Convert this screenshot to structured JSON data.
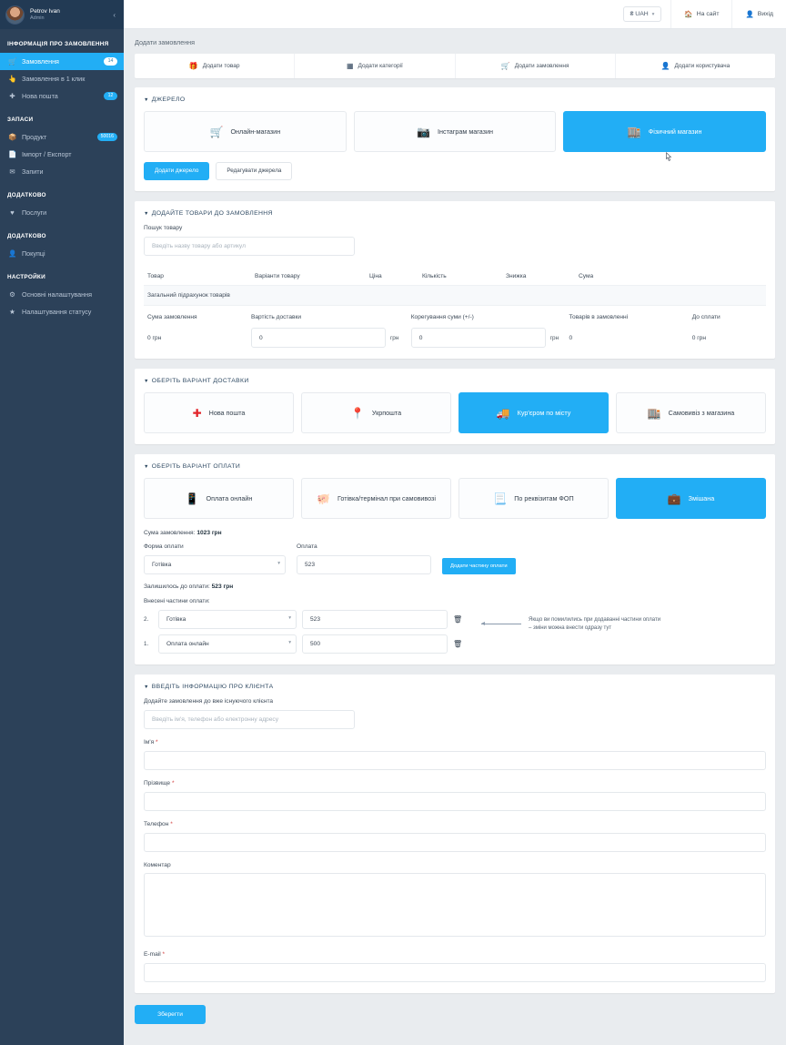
{
  "sidebar": {
    "user": {
      "name": "Petrov Ivan",
      "role": "Admin",
      "collapse_icon": "chevron-left-icon"
    },
    "groups": [
      {
        "heading": "ІНФОРМАЦІЯ ПРО ЗАМОВЛЕННЯ",
        "items": [
          {
            "label": "Замовлення",
            "icon": "cart-icon",
            "badge": "14",
            "active": true
          },
          {
            "label": "Замовлення в 1 клик",
            "icon": "hand-click-icon",
            "badge": "",
            "active": false
          },
          {
            "label": "Нова пошта",
            "icon": "np-icon",
            "badge": "12",
            "active": false
          }
        ]
      },
      {
        "heading": "ЗАПАСИ",
        "items": [
          {
            "label": "Продукт",
            "icon": "box-icon",
            "badge": "50016",
            "active": false
          },
          {
            "label": "Імпорт / Експорт",
            "icon": "file-icon",
            "badge": "",
            "active": false
          },
          {
            "label": "Запити",
            "icon": "mail-icon",
            "badge": "",
            "active": false
          }
        ]
      },
      {
        "heading": "ДОДАТКОВО",
        "items": [
          {
            "label": "Послуги",
            "icon": "tag-icon",
            "badge": "",
            "active": false
          }
        ]
      },
      {
        "heading": "ДОДАТКОВО",
        "items": [
          {
            "label": "Покупці",
            "icon": "user-icon",
            "badge": "",
            "active": false
          }
        ]
      },
      {
        "heading": "НАСТРОЙКИ",
        "items": [
          {
            "label": "Основні налаштування",
            "icon": "gear-icon",
            "badge": "",
            "active": false
          },
          {
            "label": "Налаштування статусу",
            "icon": "star-icon",
            "badge": "",
            "active": false
          }
        ]
      }
    ]
  },
  "topbar": {
    "currency": "₴ UAH",
    "currency_caret_icon": "chevron-down-icon",
    "site_link": "На сайт",
    "site_icon": "home-icon",
    "logout_link": "Вихід",
    "logout_icon": "user-icon"
  },
  "tabs": [
    {
      "label": "Додати товар",
      "icon": "gift-icon"
    },
    {
      "label": "Додати категорії",
      "icon": "grid-icon"
    },
    {
      "label": "Додати замовлення",
      "icon": "cart-icon"
    },
    {
      "label": "Додати користувача",
      "icon": "user-icon"
    }
  ],
  "breadcrumb": "Додати замовлення",
  "source": {
    "title": "ДЖЕРЕЛО",
    "options": [
      {
        "label": "Онлайн-магазин",
        "icon": "cart-icon",
        "selected": false
      },
      {
        "label": "Інстаграм магазин",
        "icon": "instagram-icon",
        "selected": false
      },
      {
        "label": "Фізичний магазин",
        "icon": "store-icon",
        "selected": true
      }
    ],
    "add_button": "Додати джерело",
    "edit_button": "Редагувати джерела"
  },
  "products": {
    "title": "ДОДАЙТЕ ТОВАРИ ДО ЗАМОВЛЕННЯ",
    "search_label": "Пошук товару",
    "search_placeholder": "Введіть назву товару або артикул",
    "search_value": "",
    "columns": [
      "Товар",
      "Варіанти товару",
      "Ціна",
      "Кількість",
      "Знижка",
      "Сума"
    ],
    "subtotal_label": "Загальний підрахунок товарів",
    "totals_labels": [
      "Сума замовлення",
      "Вартість доставки",
      "Корегування суми (+/-)",
      "Товарів в замовленні",
      "До сплати"
    ],
    "order_sum": "0 грн",
    "delivery_cost_value": "0",
    "delivery_unit": "грн",
    "adjust_value": "0",
    "adjust_unit": "грн",
    "items_count": "0",
    "to_pay": "0 грн"
  },
  "delivery": {
    "title": "ОБЕРІТЬ ВАРІАНТ ДОСТАВКИ",
    "options": [
      {
        "label": "Нова пошта",
        "icon": "np-icon",
        "selected": false
      },
      {
        "label": "Укрпошта",
        "icon": "pin-icon",
        "selected": false
      },
      {
        "label": "Кур'єром по місту",
        "icon": "truck-icon",
        "selected": true
      },
      {
        "label": "Самовивіз з магазина",
        "icon": "store-icon",
        "selected": false
      }
    ]
  },
  "payment": {
    "title": "ОБЕРІТЬ ВАРІАНТ ОПЛАТИ",
    "options": [
      {
        "label": "Оплата онлайн",
        "icon": "card-terminal-icon",
        "selected": false
      },
      {
        "label": "Готівка/термінал при самовивозі",
        "icon": "piggy-bank-icon",
        "selected": false
      },
      {
        "label": "По реквізитам ФОП",
        "icon": "document-icon",
        "selected": false
      },
      {
        "label": "Змішана",
        "icon": "wallet-icon",
        "selected": true
      }
    ],
    "order_sum_label": "Сума замовлення:",
    "order_sum_value": "1023 грн",
    "form_label": "Форма оплати",
    "form_value": "Готівка",
    "amount_label": "Оплата",
    "amount_value": "523",
    "add_part_button": "Додати частину оплати",
    "left_label": "Залишилось до оплати:",
    "left_value": "523 грн",
    "parts_label": "Внесені частини оплати:",
    "parts": [
      {
        "index": "2.",
        "method": "Готівка",
        "amount": "523",
        "delete_icon": "trash-icon"
      },
      {
        "index": "1.",
        "method": "Оплата онлайн",
        "amount": "500",
        "delete_icon": "trash-icon"
      }
    ],
    "note": "Якщо ви помилились при додаванні частини оплати – зміни можна внести одразу тут"
  },
  "client": {
    "title": "ВВЕДІТЬ ІНФОРМАЦІЮ ПРО КЛІЄНТА",
    "existing_label": "Додайте замовлення до вже існуючого клієнта",
    "existing_placeholder": "Введіть ім'я, телефон або електронну адресу",
    "existing_value": "",
    "fields": [
      {
        "label": "Ім'я",
        "required": true,
        "value": "",
        "type": "text"
      },
      {
        "label": "Прізвище",
        "required": true,
        "value": "",
        "type": "text"
      },
      {
        "label": "Телефон",
        "required": true,
        "value": "",
        "type": "text"
      },
      {
        "label": "Коментар",
        "required": false,
        "value": "",
        "type": "textarea"
      },
      {
        "label": "E-mail",
        "required": true,
        "value": "",
        "type": "text"
      }
    ]
  },
  "save_button": "Зберегти",
  "colors": {
    "accent": "#22aef5",
    "sidebar": "#2c4159",
    "page_bg": "#e9ecef",
    "required": "#d23b3b"
  }
}
